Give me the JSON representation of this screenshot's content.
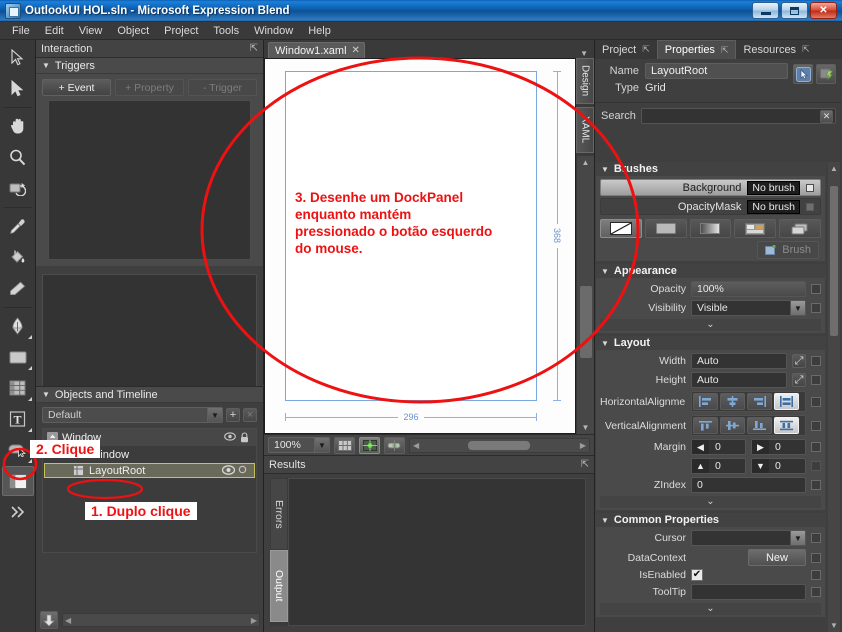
{
  "window": {
    "title": "OutlookUI HOL.sln - Microsoft Expression Blend",
    "app_icon": "blend-logo-icon",
    "minimize": "minimize-icon",
    "maximize": "maximize-icon",
    "close": "close-icon"
  },
  "menu": [
    "File",
    "Edit",
    "View",
    "Object",
    "Project",
    "Tools",
    "Window",
    "Help"
  ],
  "tools": [
    {
      "name": "selection-tool",
      "icon": "arrow-outline-icon"
    },
    {
      "name": "direct-selection-tool",
      "icon": "arrow-solid-icon"
    },
    {
      "name": "pan-tool",
      "icon": "hand-icon"
    },
    {
      "name": "zoom-tool",
      "icon": "magnifier-icon"
    },
    {
      "name": "camera-orbit-tool",
      "icon": "camera-orbit-icon"
    },
    {
      "name": "eyedropper-tool",
      "icon": "eyedropper-icon"
    },
    {
      "name": "paint-bucket-tool",
      "icon": "paint-bucket-icon"
    },
    {
      "name": "brush-transform-tool",
      "icon": "eraser-icon"
    },
    {
      "name": "pen-tool",
      "icon": "pen-nib-icon"
    },
    {
      "name": "rectangle-tool",
      "icon": "rectangle-icon"
    },
    {
      "name": "grid-tool",
      "icon": "grid-panel-icon"
    },
    {
      "name": "text-tool",
      "icon": "text-t-icon"
    },
    {
      "name": "button-tool",
      "icon": "button-cursor-icon"
    },
    {
      "name": "dockpanel-tool",
      "icon": "dockpanel-icon"
    },
    {
      "name": "assets-tool",
      "icon": "double-chevron-icon"
    }
  ],
  "interaction": {
    "title": "Interaction",
    "expand_icon": "expand-panel-icon",
    "triggers": {
      "label": "Triggers",
      "buttons": [
        {
          "label": "+ Event",
          "enabled": true
        },
        {
          "label": "+ Property",
          "enabled": false
        },
        {
          "label": "- Trigger",
          "enabled": false
        }
      ]
    }
  },
  "objects_panel": {
    "title": "Objects and Timeline",
    "storyboard_selected": "Default",
    "add_icon": "plus-icon",
    "close_icon": "x-icon",
    "dropdown_icon": "chevron-down-icon",
    "tree": [
      {
        "label": "Window",
        "level": 0,
        "kind": "scope",
        "icons": [
          "eye-icon",
          "lock-icon"
        ]
      },
      {
        "label": "Window",
        "level": 1,
        "kind": "node",
        "icons": [
          "eye-icon"
        ]
      },
      {
        "label": "LayoutRoot",
        "level": 2,
        "kind": "selected",
        "icons": [
          "eye-icon",
          "lock-open-icon"
        ]
      }
    ],
    "download_icon": "down-arrow-icon",
    "scroll_left_icon": "left-arrow-icon",
    "scroll_right_icon": "right-arrow-icon"
  },
  "document": {
    "tab_label": "Window1.xaml",
    "tab_close_icon": "x-icon",
    "tabstrip_menu_icon": "chevron-down-icon",
    "view_tabs": [
      "Design",
      "XAML"
    ],
    "artboard": {
      "width_label": "296",
      "height_label": "368",
      "annotation": "3. Desenhe um DockPanel enquanto mantém pressionado o botão esquerdo do mouse."
    },
    "zoombar": {
      "zoom_value": "100%",
      "dropdown_icon": "chevron-down-icon",
      "buttons": [
        {
          "name": "show-grid-button",
          "icon": "grid-icon"
        },
        {
          "name": "snap-to-gridlines-button",
          "icon": "snap-grid-icon"
        },
        {
          "name": "snap-to-snaplines-button",
          "icon": "snaplines-icon"
        }
      ]
    }
  },
  "results": {
    "title": "Results",
    "expand_icon": "expand-panel-icon",
    "tabs": [
      {
        "label": "Errors",
        "selected": false
      },
      {
        "label": "Output",
        "selected": true
      }
    ]
  },
  "properties": {
    "tabs": [
      {
        "label": "Project",
        "selected": false,
        "expand_icon": "expand-panel-icon"
      },
      {
        "label": "Properties",
        "selected": true,
        "expand_icon": "expand-panel-icon"
      },
      {
        "label": "Resources",
        "selected": false,
        "expand_icon": "expand-panel-icon"
      }
    ],
    "name_label": "Name",
    "name_value": "LayoutRoot",
    "type_label": "Type",
    "type_value": "Grid",
    "name_buttons": [
      {
        "name": "edit-style-button",
        "icon": "style-cursor-icon"
      },
      {
        "name": "edit-template-button",
        "icon": "template-icon"
      }
    ],
    "search_label": "Search",
    "search_value": "",
    "search_clear_icon": "x-icon",
    "sections": {
      "brushes": {
        "title": "Brushes",
        "rows": [
          {
            "label": "Background",
            "value": "No brush",
            "selected": true
          },
          {
            "label": "OpacityMask",
            "value": "No brush",
            "selected": false
          }
        ],
        "swatches": [
          {
            "name": "no-brush-swatch",
            "icon": "diagonal-slash-icon",
            "selected": true
          },
          {
            "name": "solid-color-brush-swatch",
            "icon": "solid-square-icon",
            "selected": false
          },
          {
            "name": "gradient-brush-swatch",
            "icon": "gradient-square-icon",
            "selected": false
          },
          {
            "name": "tile-brush-swatch",
            "icon": "tile-brush-icon",
            "selected": false
          },
          {
            "name": "brush-resources-swatch",
            "icon": "stacked-squares-icon",
            "selected": false
          }
        ],
        "brush_button_label": "Brush",
        "brush_button_icon": "add-brush-icon"
      },
      "appearance": {
        "title": "Appearance",
        "opacity_label": "Opacity",
        "opacity_value": "100%",
        "visibility_label": "Visibility",
        "visibility_value": "Visible",
        "expand_icon": "chevron-down-icon"
      },
      "layout": {
        "title": "Layout",
        "width_label": "Width",
        "width_value": "Auto",
        "height_label": "Height",
        "height_value": "Auto",
        "autosize_icon": "auto-size-icon",
        "halign_label": "HorizontalAlignme...",
        "halign_options": [
          "align-left-icon",
          "align-center-icon",
          "align-right-icon",
          "align-stretch-icon"
        ],
        "halign_selected": 3,
        "valign_label": "VerticalAlignment",
        "valign_options": [
          "align-top-icon",
          "align-middle-icon",
          "align-bottom-icon",
          "align-vstretch-icon"
        ],
        "valign_selected": 3,
        "margin_label": "Margin",
        "margin_left": "0",
        "margin_right": "0",
        "margin_top": "0",
        "margin_bottom": "0",
        "margin_left_icon": "arrow-left-icon",
        "margin_right_icon": "arrow-right-icon",
        "margin_top_icon": "arrow-up-icon",
        "margin_bottom_icon": "arrow-down-icon",
        "zindex_label": "ZIndex",
        "zindex_value": "0",
        "expand_icon": "chevron-down-icon"
      },
      "common": {
        "title": "Common Properties",
        "cursor_label": "Cursor",
        "cursor_value": "",
        "datacontext_label": "DataContext",
        "datacontext_button": "New",
        "isenabled_label": "IsEnabled",
        "isenabled_checked": true,
        "check_icon": "checkmark-icon",
        "tooltip_label": "ToolTip",
        "tooltip_value": "",
        "expand_icon": "chevron-down-icon"
      }
    }
  },
  "annotations": {
    "step1": "1. Duplo clique",
    "step2": "2. Clique",
    "accent_color": "#ef1111"
  }
}
